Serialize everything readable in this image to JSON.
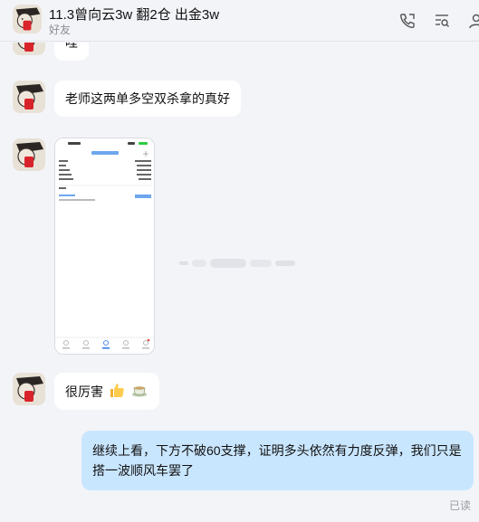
{
  "header": {
    "title": "11.3曾向云3w 翻2仓 出金3w",
    "subtitle": "好友",
    "icons": [
      "phone-call-icon",
      "history-search-icon",
      "user-icon"
    ]
  },
  "messages": [
    {
      "from": "contact",
      "text": "哇"
    },
    {
      "from": "contact",
      "text": "老师这两单多空双杀拿的真好"
    },
    {
      "from": "contact",
      "type": "image"
    },
    {
      "from": "contact",
      "text": "很厉害",
      "emojis": [
        "thumbs-up-icon",
        "tea-cup-icon"
      ]
    },
    {
      "from": "me",
      "text": "继续上看，下方不破60支撑，证明多头依然有力度反弹，我们只是搭一波顺风车罢了"
    }
  ],
  "read_status": "已读",
  "colors": {
    "background": "#f3f4f8",
    "my_bubble": "#c9e6ff",
    "other_bubble": "#ffffff"
  }
}
